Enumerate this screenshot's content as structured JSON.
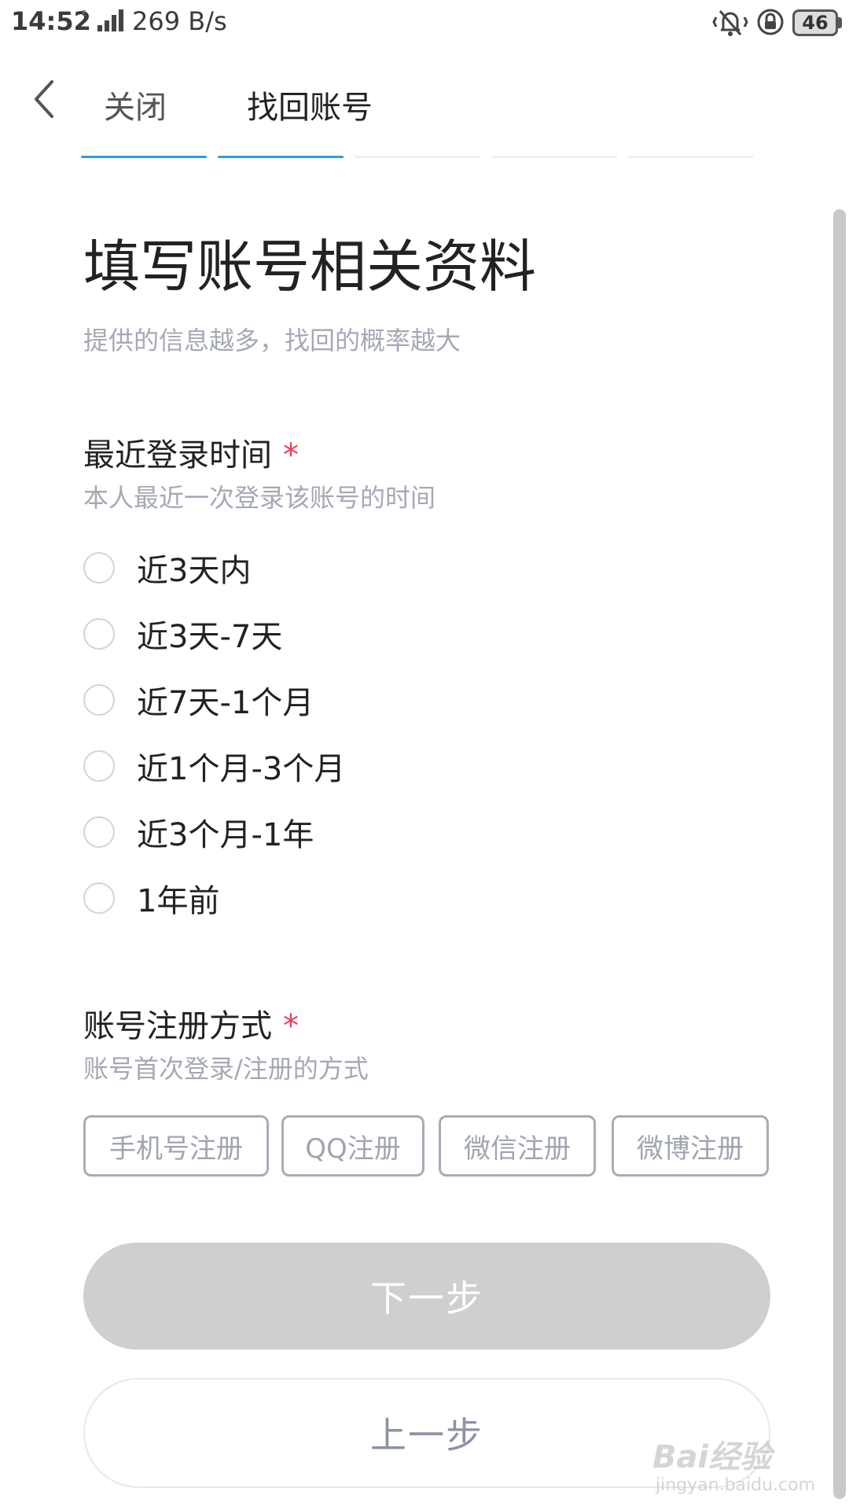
{
  "status_bar": {
    "time": "14:52",
    "network_speed": "269 B/s",
    "battery_level": "46"
  },
  "header": {
    "close_label": "关闭",
    "title": "找回账号"
  },
  "progress": {
    "total_steps": 5,
    "completed_steps": 2,
    "active_color": "#2f9ae8",
    "inactive_color": "#eef0f3"
  },
  "main": {
    "heading": "填写账号相关资料",
    "subtitle": "提供的信息越多，找回的概率越大",
    "login_time": {
      "title": "最近登录时间",
      "required_mark": "*",
      "description": "本人最近一次登录该账号的时间",
      "options": [
        "近3天内",
        "近3天-7天",
        "近7天-1个月",
        "近1个月-3个月",
        "近3个月-1年",
        "1年前"
      ]
    },
    "registration": {
      "title": "账号注册方式",
      "required_mark": "*",
      "description": "账号首次登录/注册的方式",
      "options": [
        "手机号注册",
        "QQ注册",
        "微信注册",
        "微博注册"
      ]
    }
  },
  "buttons": {
    "next_label": "下一步",
    "prev_label": "上一步"
  },
  "watermark": {
    "logo_text": "Bai经验",
    "url": "jingyan.baidu.com"
  }
}
